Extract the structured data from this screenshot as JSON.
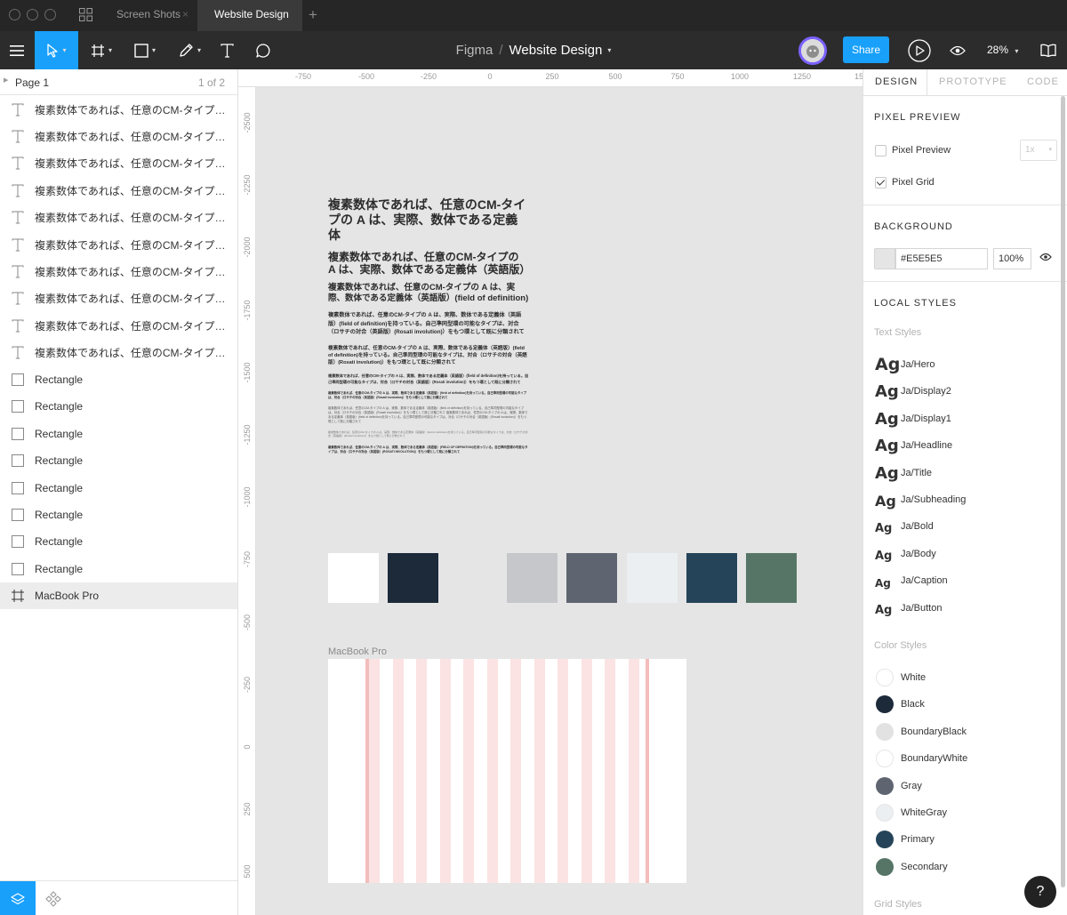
{
  "tabs": [
    {
      "label": "Screen Shots",
      "close": "×"
    },
    {
      "label": "Website Design",
      "close": "×"
    }
  ],
  "tab_add": "+",
  "toolbar": {
    "project": "Figma",
    "separator": "/",
    "file": "Website Design",
    "share_label": "Share",
    "zoom": "28%"
  },
  "pages": {
    "current": "Page 1",
    "count": "1 of 2"
  },
  "layers": [
    {
      "type": "text",
      "label": "複素数体であれば、任意のCM-タイプの A は、実際、数体である定義体"
    },
    {
      "type": "text",
      "label": "複素数体であれば、任意のCM-タイプの A は、実際、数体である定義体（英語版）"
    },
    {
      "type": "text",
      "label": "複素数体であれば、任意のCM-タイプの A は、実際、数体である定義体（英語版）(field of definition)"
    },
    {
      "type": "text",
      "label": "複素数体であれば、任意のCM-タイプの A は、実際、数体である定義体（英語版）(field of definition)を持っている。"
    },
    {
      "type": "text",
      "label": "複素数体であれば、任意のCM-タイプの A は、実際、数体である定義体（英語版）"
    },
    {
      "type": "text",
      "label": "複素数体であれば、任意のCM-タイプの A は、実際、数体である定義体（英語版）"
    },
    {
      "type": "text",
      "label": "複素数体であれば、任意のCM-タイプの A は、実際、数体である定義体（英語版）"
    },
    {
      "type": "text",
      "label": "複素数体であれば、任意のCM-タイプの A は、実際、数体である定義体（英語版）"
    },
    {
      "type": "text",
      "label": "複素数体であれば、任意のCM-タイプの A は、実際、数体である定義体（英語版）"
    },
    {
      "type": "text",
      "label": "複素数体であれば、任意のCM-タイプの A は、実際、数体である定義体（英語版）"
    },
    {
      "type": "rect",
      "label": "Rectangle"
    },
    {
      "type": "rect",
      "label": "Rectangle"
    },
    {
      "type": "rect",
      "label": "Rectangle"
    },
    {
      "type": "rect",
      "label": "Rectangle"
    },
    {
      "type": "rect",
      "label": "Rectangle"
    },
    {
      "type": "rect",
      "label": "Rectangle"
    },
    {
      "type": "rect",
      "label": "Rectangle"
    },
    {
      "type": "rect",
      "label": "Rectangle"
    },
    {
      "type": "frame",
      "label": "MacBook Pro"
    }
  ],
  "ruler_top": [
    "-750",
    "-500",
    "-250",
    "0",
    "250",
    "500",
    "750",
    "1000",
    "1250",
    "15"
  ],
  "ruler_left": [
    "-2500",
    "-2250",
    "-2000",
    "-1750",
    "-1500",
    "-1250",
    "-1000",
    "-750",
    "-500",
    "-250",
    "0",
    "250",
    "500"
  ],
  "canvas": {
    "typography": [
      "複素数体であれば、任意のCM-タイプの A は、実際、数体である定義体",
      "複素数体であれば、任意のCM-タイプの A は、実際、数体である定義体（英語版）",
      "複素数体であれば、任意のCM-タイプの A は、実際、数体である定義体（英語版）(field of definition)",
      "複素数体であれば、任意のCM-タイプの A は、実際、数体である定義体（英語版）(field of definition)を持っている。自己準同型環の可能なタイプは、対合（ロサチの対合（英語版）(Rosati involution)）をもつ環として既に分類されて",
      "複素数体であれば、任意のCM-タイプの A は、実際、数体である定義体（英語版）(field of definition)を持っている。自己準同型環の可能なタイプは、対合（ロサチの対合（英語版）(Rosati involution)）をもつ環として既に分類されて",
      "複素数体であれば、任意のCM-タイプの A は、実際、数体である定義体（英語版）(field of definition)を持っている。自己準同型環の可能なタイプは、対合（ロサチの対合（英語版）(Rosati involution)）をもつ環として既に分類されて",
      "複素数体であれば、任意のCM-タイプの A は、実際、数体である定義体（英語版）(field of definition)を持っている。自己準同型環の可能なタイプは、対合（ロサチの対合（英語版）(Rosati involution)）をもつ環として既に分類されて",
      "複素数体であれば、任意のCM-タイプの A は、実際、数体である定義体（英語版）(field of definition)を持っている。自己準同型環の可能なタイプは、対合（ロサチの対合（英語版）(Rosati involution)）をもつ環として既に分類されて 複素数体であれば、任意のCM-タイプの A は、実際、数体である定義体（英語版）(field of definition)を持っている。自己準同型環の可能なタイプは、対合（ロサチの対合（英語版）(Rosati involution)）をもつ環として既に分類されて",
      "複素数体であれば、任意のCM-タイプの A は、実際、数体である定義体（英語版）(field of definition)を持っている。自己準同型環の可能なタイプは、対合（ロサチの対合（英語版）(Rosati involution)）をもつ環として既に分類されて",
      "複素数体であれば、任意のCM-タイプの A は、実際、数体である定義体（英語版）(FIELD OF DEFINITION)を持っている。自己準同型環の可能なタイプは、対合（ロサチの対合（英語版）(ROSATI INVOLUTION)）をもつ環として既に分類されて"
    ],
    "swatches": [
      "#FFFFFF",
      "#1C2A3A",
      "#E5E5E5",
      "#C6C7CA",
      "#5F6570",
      "#EBEFF2",
      "#254459",
      "#567566"
    ],
    "frame_label": "MacBook Pro"
  },
  "right": {
    "tabs": [
      "DESIGN",
      "PROTOTYPE",
      "CODE"
    ],
    "pixel_preview": {
      "title": "PIXEL PREVIEW",
      "preview_label": "Pixel Preview",
      "grid_label": "Pixel Grid",
      "preview_checked": false,
      "grid_checked": true,
      "scale": "1x"
    },
    "background": {
      "title": "BACKGROUND",
      "hex": "#E5E5E5",
      "opacity": "100%"
    },
    "local_styles": {
      "title": "LOCAL STYLES",
      "text_title": "Text Styles",
      "ag": "Ag",
      "text_styles": [
        "Ja/Hero",
        "Ja/Display2",
        "Ja/Display1",
        "Ja/Headline",
        "Ja/Title",
        "Ja/Subheading",
        "Ja/Bold",
        "Ja/Body",
        "Ja/Caption",
        "Ja/Button"
      ],
      "color_title": "Color Styles",
      "color_styles": [
        {
          "name": "White",
          "color": "#FFFFFF"
        },
        {
          "name": "Black",
          "color": "#1C2A3A"
        },
        {
          "name": "BoundaryBlack",
          "color": "#E2E2E2"
        },
        {
          "name": "BoundaryWhite",
          "color": "#FFFFFF"
        },
        {
          "name": "Gray",
          "color": "#5F6570"
        },
        {
          "name": "WhiteGray",
          "color": "#EBEFF2"
        },
        {
          "name": "Primary",
          "color": "#254459"
        },
        {
          "name": "Secondary",
          "color": "#567566"
        }
      ],
      "grid_title": "Grid Styles"
    }
  },
  "help": "?"
}
